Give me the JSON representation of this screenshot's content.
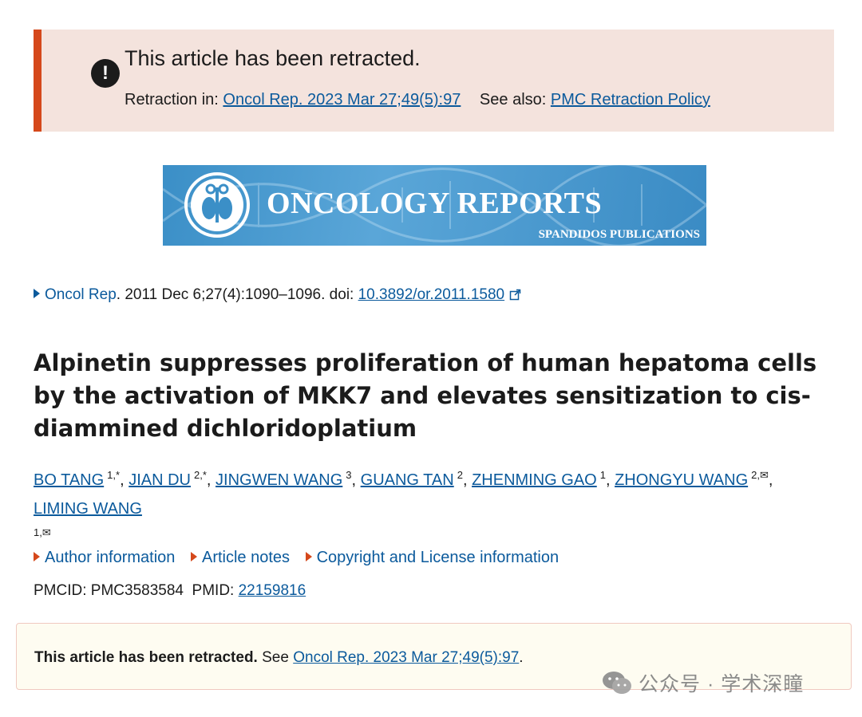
{
  "retraction_banner": {
    "title": "This article has been retracted.",
    "retraction_in_label": "Retraction in:",
    "retraction_in_link": "Oncol Rep. 2023 Mar 27;49(5):97",
    "see_also_label": "See also:",
    "see_also_link": "PMC Retraction Policy",
    "accent_color": "#d5481b"
  },
  "journal_logo": {
    "title": "ONCOLOGY REPORTS",
    "publisher": "SPANDIDOS PUBLICATIONS"
  },
  "citation": {
    "journal": "Oncol Rep",
    "details": "2011 Dec 6;27(4):1090–1096. doi:",
    "doi": "10.3892/or.2011.1580"
  },
  "article": {
    "title": "Alpinetin suppresses proliferation of human hepatoma cells by the activation of MKK7 and elevates sensitization to cis-diammined dichloridoplatium"
  },
  "authors": [
    {
      "name": "BO TANG",
      "aff": "1,*"
    },
    {
      "name": "JIAN DU",
      "aff": "2,*"
    },
    {
      "name": "JINGWEN WANG",
      "aff": "3"
    },
    {
      "name": "GUANG TAN",
      "aff": "2"
    },
    {
      "name": "ZHENMING GAO",
      "aff": "1"
    },
    {
      "name": "ZHONGYU WANG",
      "aff": "2,✉"
    },
    {
      "name": "LIMING WANG",
      "aff": "1,✉"
    }
  ],
  "expanders": {
    "author_info": "Author information",
    "article_notes": "Article notes",
    "copyright": "Copyright and License information"
  },
  "ids": {
    "pmcid_label": "PMCID:",
    "pmcid": "PMC3583584",
    "pmid_label": "PMID:",
    "pmid": "22159816"
  },
  "notice": {
    "bold": "This article has been retracted.",
    "see": "See",
    "link": "Oncol Rep. 2023 Mar 27;49(5):97",
    "end": "."
  },
  "watermark": {
    "text": "公众号 · 学术深瞳"
  }
}
